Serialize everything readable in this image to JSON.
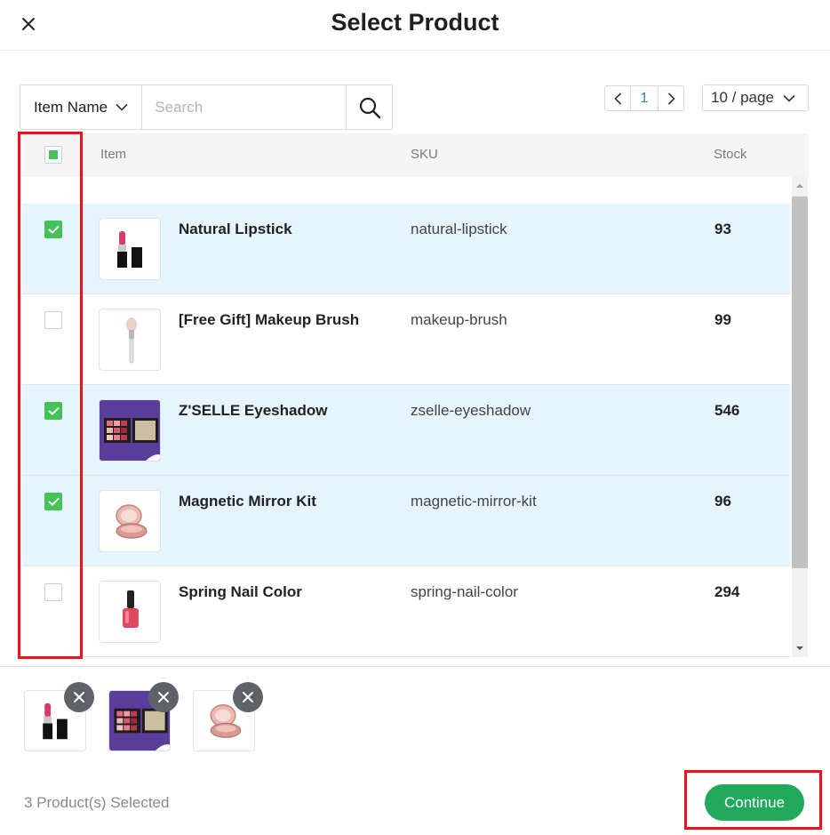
{
  "modal": {
    "title": "Select Product"
  },
  "filter": {
    "field_label": "Item Name",
    "search_placeholder": "Search"
  },
  "pagination": {
    "current_page": "1",
    "page_size_label": "10 / page"
  },
  "table": {
    "columns": {
      "item": "Item",
      "sku": "SKU",
      "stock": "Stock"
    },
    "rows": [
      {
        "name": "Natural Lipstick",
        "sku": "natural-lipstick",
        "stock": "93",
        "checked": true,
        "icon": "lipstick-image"
      },
      {
        "name": "[Free Gift] Makeup Brush",
        "sku": "makeup-brush",
        "stock": "99",
        "checked": false,
        "icon": "makeup-brush-image"
      },
      {
        "name": "Z'SELLE Eyeshadow",
        "sku": "zselle-eyeshadow",
        "stock": "546",
        "checked": true,
        "icon": "eyeshadow-palette-image"
      },
      {
        "name": "Magnetic Mirror Kit",
        "sku": "magnetic-mirror-kit",
        "stock": "96",
        "checked": true,
        "icon": "compact-mirror-image"
      },
      {
        "name": "Spring Nail Color",
        "sku": "spring-nail-color",
        "stock": "294",
        "checked": false,
        "icon": "nail-polish-image"
      }
    ]
  },
  "footer": {
    "selected_count_label": "3 Product(s) Selected",
    "continue_label": "Continue"
  },
  "colors": {
    "accent_green": "#44c157",
    "continue_green": "#21a95c",
    "selected_row_bg": "#e5f4fd",
    "highlight_red": "#e8141a",
    "link_blue": "#2f80d1"
  }
}
